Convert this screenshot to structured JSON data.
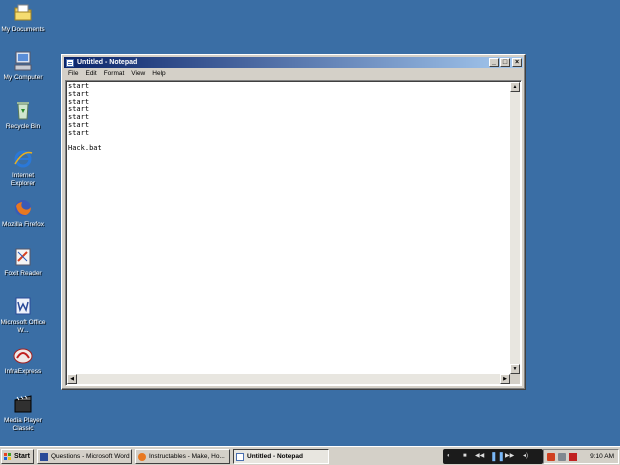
{
  "desktop": {
    "icons": [
      {
        "label": "My Documents"
      },
      {
        "label": "My Computer"
      },
      {
        "label": "Recycle Bin"
      },
      {
        "label": "Internet Explorer"
      },
      {
        "label": "Mozilla Firefox"
      },
      {
        "label": "Foxit Reader"
      },
      {
        "label": "Microsoft Office W..."
      },
      {
        "label": "InfraExpress"
      },
      {
        "label": "Media Player Classic"
      }
    ],
    "background_color": "#3a6ea5"
  },
  "window": {
    "title": "Untitled - Notepad",
    "controls": {
      "minimize": "_",
      "maximize": "□",
      "close": "×"
    },
    "menu": [
      "File",
      "Edit",
      "Format",
      "View",
      "Help"
    ],
    "content": "start\nstart\nstart\nstart\nstart\nstart\nstart\n\nHack.bat"
  },
  "taskbar": {
    "start_label": "Start",
    "tasks": [
      {
        "label": "Questions - Microsoft Word",
        "active": false
      },
      {
        "label": "Instructables - Make, Ho...",
        "active": false
      },
      {
        "label": "Untitled - Notepad",
        "active": true
      }
    ],
    "clock": "9:10 AM"
  }
}
